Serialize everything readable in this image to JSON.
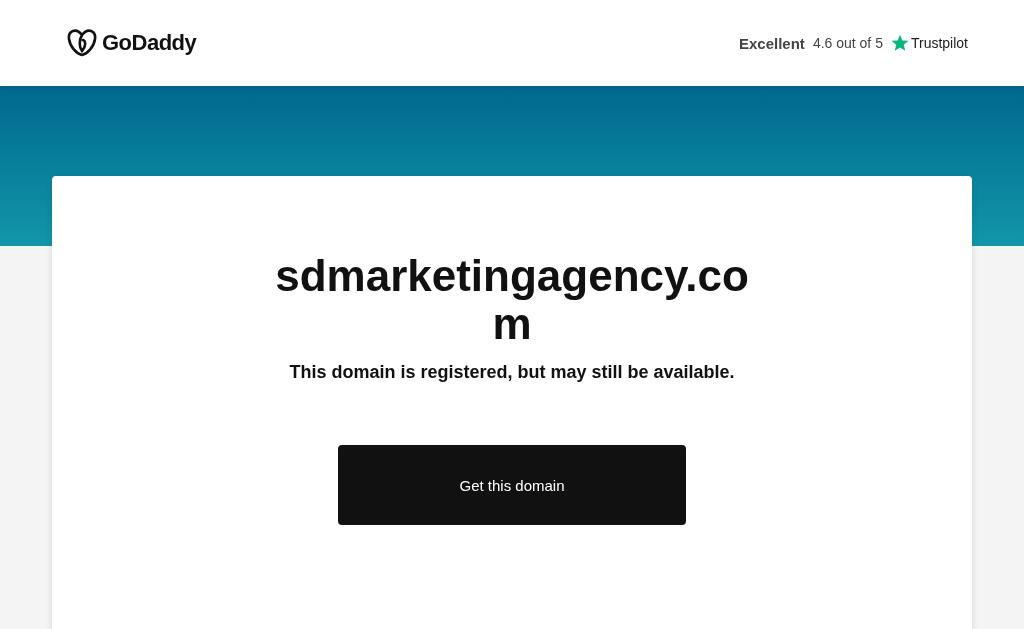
{
  "header": {
    "logo": "GoDaddy",
    "rating": {
      "label": "Excellent",
      "score": "4.6 out of 5",
      "brand": "Trustpilot"
    }
  },
  "domain": {
    "name": "sdmarketingagency.com",
    "message": "This domain is registered, but may still be available.",
    "button": "Get this domain"
  }
}
